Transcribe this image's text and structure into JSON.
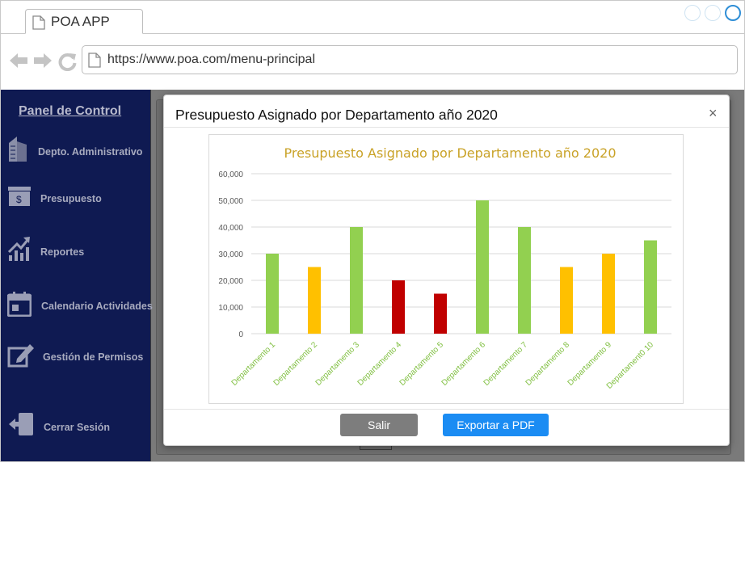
{
  "browser": {
    "tab_title": "POA APP",
    "url": "https://www.poa.com/menu-principal"
  },
  "sidebar": {
    "title": "Panel de Control",
    "items": [
      {
        "label": "Depto. Administrativo",
        "icon": "building-icon"
      },
      {
        "label": "Presupuesto",
        "icon": "money-icon"
      },
      {
        "label": "Reportes",
        "icon": "chart-up-icon"
      },
      {
        "label": "Calendario Actividades",
        "icon": "calendar-icon"
      },
      {
        "label": "Gestión de Permisos",
        "icon": "edit-icon"
      },
      {
        "label": "Cerrar Sesión",
        "icon": "logout-icon"
      }
    ]
  },
  "modal": {
    "title": "Presupuesto Asignado por Departamento año 2020",
    "close_label": "×",
    "buttons": {
      "exit_label": "Salir",
      "export_label": "Exportar a PDF"
    }
  },
  "colors": {
    "sidebar_bg": "#0f1a52",
    "green": "#92d050",
    "orange": "#ffc000",
    "red": "#c00000",
    "chart_title": "#c9a227",
    "primary_button": "#1b8cf3",
    "secondary_button": "#7d7d7d"
  },
  "chart_data": {
    "type": "bar",
    "title": "Presupuesto Asignado por Departamento año 2020",
    "categories": [
      "Departamento 1",
      "Departamento 2",
      "Departamento 3",
      "Departamento 4",
      "Departamento 5",
      "Departamento 6",
      "Departamento 7",
      "Departamento 8",
      "Departamento 9",
      "Departament0 10"
    ],
    "values": [
      30000,
      25000,
      40000,
      20000,
      15000,
      50000,
      40000,
      25000,
      30000,
      35000
    ],
    "bar_colors": [
      "green",
      "orange",
      "green",
      "red",
      "red",
      "green",
      "green",
      "orange",
      "orange",
      "green"
    ],
    "y_ticks": [
      "0",
      "10,000",
      "20,000",
      "30,000",
      "40,000",
      "50,000",
      "60,000"
    ],
    "ylim": [
      0,
      60000
    ],
    "grid": true,
    "legend": "none"
  }
}
